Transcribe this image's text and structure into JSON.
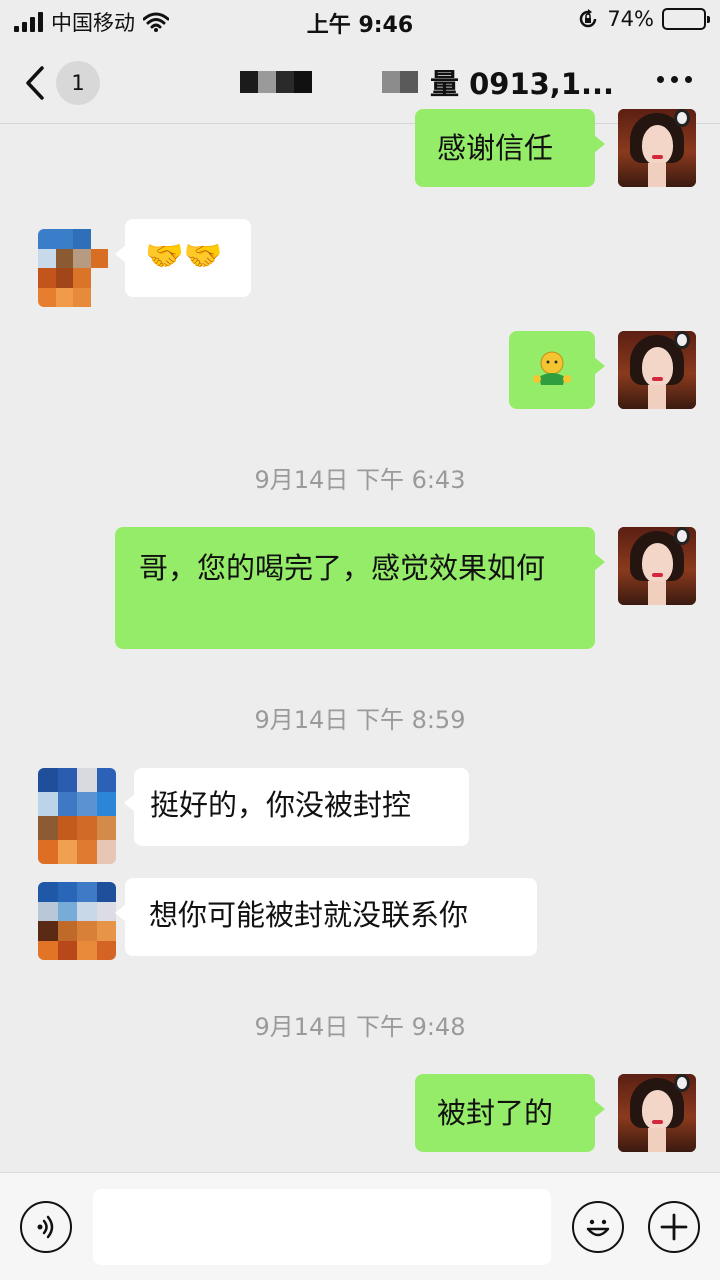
{
  "status_bar": {
    "carrier": "中国移动",
    "time": "上午 9:46",
    "battery_percent_text": "74%",
    "battery_level": 0.74
  },
  "nav": {
    "back_badge": "1",
    "title": "量 0913,1...",
    "more_icon": "more-icon"
  },
  "messages": [
    {
      "sender": "me",
      "text": "感谢信任"
    },
    {
      "sender": "them",
      "text": "🤝🤝"
    },
    {
      "sender": "me",
      "text": "🫥"
    },
    {
      "type": "timestamp",
      "text": "9月14日 下午 6:43"
    },
    {
      "sender": "me",
      "text": "哥，您的喝完了，感觉效果如何"
    },
    {
      "type": "timestamp",
      "text": "9月14日 下午 8:59"
    },
    {
      "sender": "them",
      "text": "挺好的，你没被封控"
    },
    {
      "sender": "them",
      "text": "想你可能被封就没联系你"
    },
    {
      "type": "timestamp",
      "text": "9月14日 下午 9:48"
    },
    {
      "sender": "me",
      "text": "被封了的"
    }
  ],
  "input_bar": {
    "voice_icon": "voice-icon",
    "emoji_icon": "emoji-icon",
    "plus_icon": "plus-icon",
    "text_value": ""
  },
  "colors": {
    "background": "#ededed",
    "my_bubble": "#95ec69",
    "their_bubble": "#ffffff",
    "timestamp": "#9a9a9a"
  }
}
